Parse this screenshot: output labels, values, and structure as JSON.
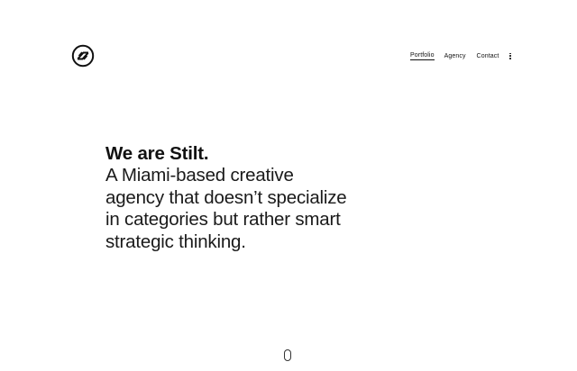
{
  "brand": {
    "logo_icon": "stilt-logo-icon"
  },
  "nav": {
    "items": [
      {
        "label": "Portfolio",
        "active": true
      },
      {
        "label": "Agency",
        "active": false
      },
      {
        "label": "Contact",
        "active": false
      }
    ],
    "more_icon": "kebab-menu-icon"
  },
  "hero": {
    "title": "We are Stilt.",
    "lines": [
      "A Miami-based creative",
      "agency that doesn’t specialize",
      "in categories but rather smart",
      "strategic thinking."
    ]
  },
  "scroll": {
    "icon": "mouse-scroll-icon"
  },
  "colors": {
    "background": "#ffffff",
    "text": "#111111"
  }
}
